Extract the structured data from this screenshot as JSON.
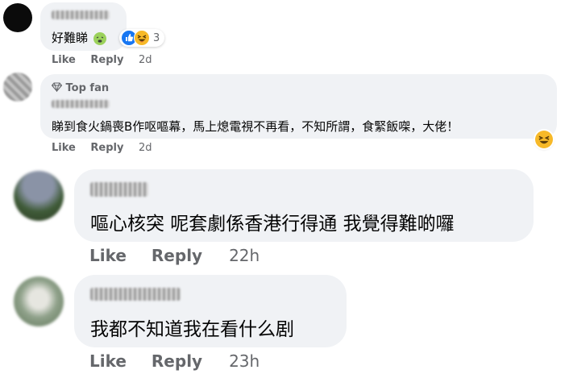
{
  "comments": [
    {
      "text": "好難睇",
      "reactions_count": "3",
      "like": "Like",
      "reply": "Reply",
      "time": "2d"
    },
    {
      "badge": "Top fan",
      "text": "睇到食火鍋喪B作呕嘔幕，馬上熄電視不再看，不知所謂，食緊飯㗎，大佬！",
      "like": "Like",
      "reply": "Reply",
      "time": "2d"
    },
    {
      "text": "嘔心核突 呢套劇係香港行得通 我覺得難啲囉",
      "like": "Like",
      "reply": "Reply",
      "time": "22h"
    },
    {
      "text": "我都不知道我在看什么剧",
      "like": "Like",
      "reply": "Reply",
      "time": "23h"
    }
  ],
  "colors": {
    "bubble": "#f0f2f5",
    "meta": "#65676b",
    "like_blue": "#1877f2",
    "haha_yellow": "#f7b928"
  },
  "icons": [
    "like-reaction-icon",
    "haha-reaction-icon",
    "diamond-icon",
    "sick-face-emoji"
  ]
}
